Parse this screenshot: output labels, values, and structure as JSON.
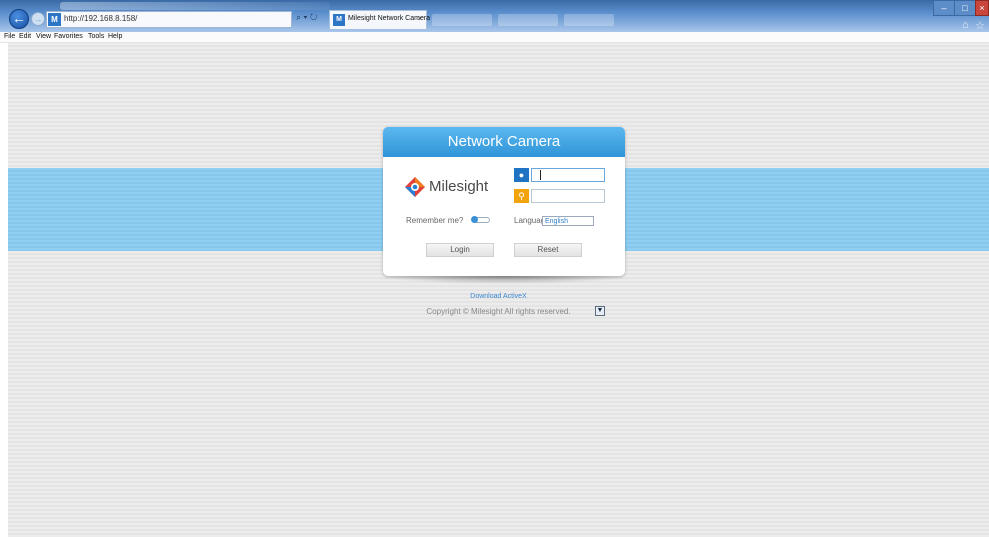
{
  "browser": {
    "url": "http://192.168.8.158/",
    "tab_title": "Milesight Network Camera",
    "tab_close": "×",
    "address_icons": "⌕ ▾ ↻",
    "site_favicon": "M",
    "menu": [
      "File",
      "Edit",
      "View",
      "Favorites",
      "Tools",
      "Help"
    ]
  },
  "login": {
    "title": "Network Camera",
    "brand": "Milesight",
    "username_value": "",
    "password_value": "",
    "remember_label": "Remember me?",
    "language_label": "Language:",
    "language_value": "English",
    "login_button": "Login",
    "reset_button": "Reset"
  },
  "footer": {
    "download_link": "Download ActiveX",
    "copyright": "Copyright © Milesight All rights reserved."
  },
  "colors": {
    "header_blue": "#2f94d8",
    "band_blue": "#8fcdf1",
    "user_icon": "#1f73c2",
    "key_icon": "#f2a40f",
    "logo_orange": "#f07c1e",
    "logo_red": "#e2403a",
    "logo_blue": "#2a7fd4"
  },
  "icons": {
    "back": "back-arrow-icon",
    "forward": "forward-arrow-icon",
    "user": "user-icon",
    "key": "key-icon",
    "home": "home-icon",
    "favorites": "star-icon"
  }
}
